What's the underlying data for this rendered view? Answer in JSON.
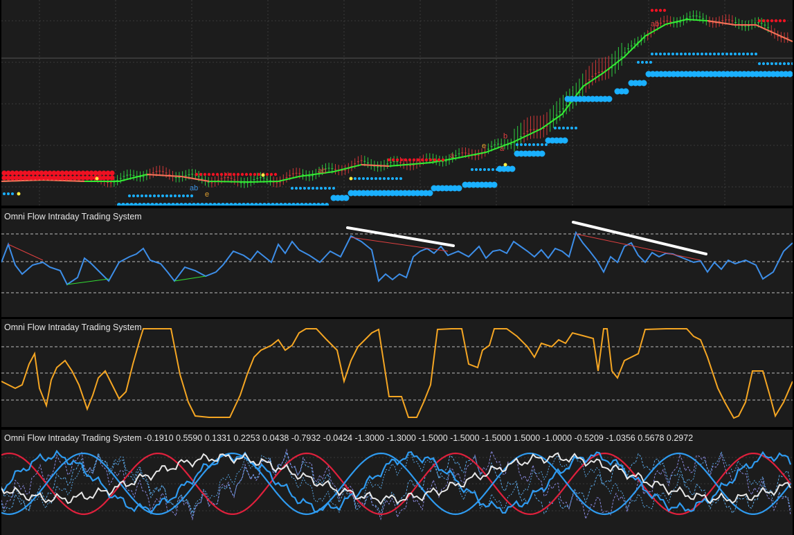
{
  "colors": {
    "background": "#1c1c1c",
    "grid": "#3a3a3a",
    "up_candle": "#2ecc40",
    "down_candle": "#d03838",
    "moving_average_up": "#33ee33",
    "moving_average_down": "#ff6a5a",
    "support_dots": "#1ab0ff",
    "resistance_dots": "#ee1122",
    "marker_yellow": "#ffee44",
    "oscillator_blue": "#3d8ee8",
    "oscillator_orange": "#f5a623",
    "trendline_white": "#ffffff",
    "wave_red": "#e0203c",
    "wave_blue": "#2f9bf0",
    "wave_white": "#e8e8e8",
    "wave_dashed": "#5aa8e8",
    "title_text": "#e6e6e6"
  },
  "price_panel": {
    "markers": [
      {
        "label": "ab",
        "color": "#3a90e0"
      },
      {
        "label": "e",
        "color": "#e0a030"
      },
      {
        "label": "ab",
        "color": "#e04040"
      },
      {
        "label": "a",
        "color": "#e04040"
      },
      {
        "label": "e",
        "color": "#e0a030"
      },
      {
        "label": "a",
        "color": "#e04040"
      },
      {
        "label": "b",
        "color": "#e04040"
      },
      {
        "label": "ab",
        "color": "#e04040"
      }
    ]
  },
  "panels": [
    {
      "title": "Omni Flow Intraday Trading System"
    },
    {
      "title": "Omni Flow Intraday Trading System"
    },
    {
      "title": "Omni Flow Intraday Trading System -0.1910 0.5590 0.1331 0.2253 0.0438 -0.7932 -0.0424 -1.3000 -1.3000 -1.5000 -1.5000 -1.5000 1.5000 -1.0000 -0.5209 -1.0356 0.5678 0.2972"
    }
  ]
}
